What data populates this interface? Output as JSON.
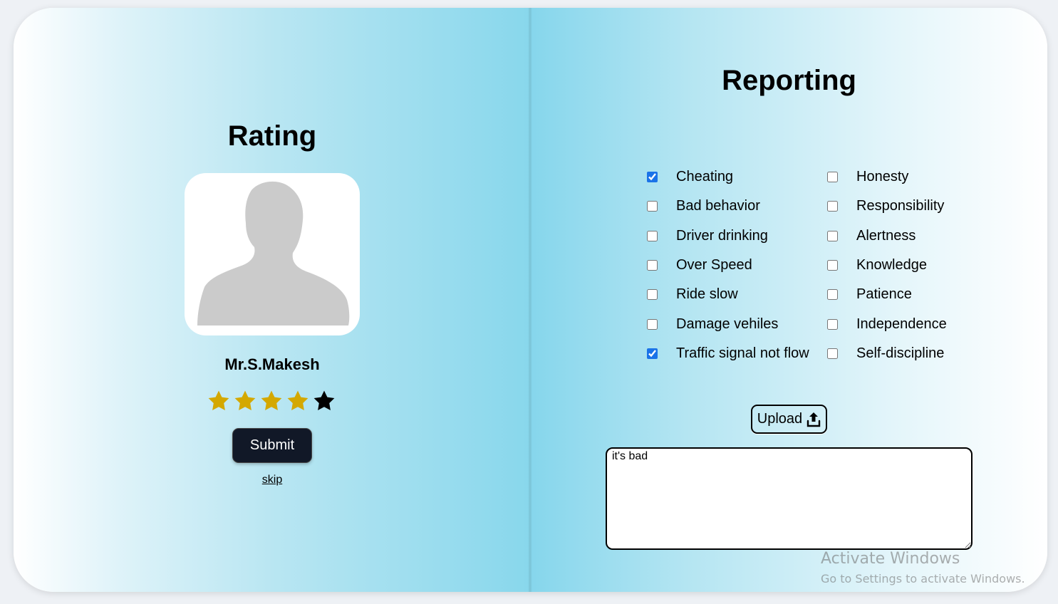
{
  "rating": {
    "title": "Rating",
    "driver_name": "Mr.S.Makesh",
    "stars_filled": 4,
    "stars_total": 5,
    "star_filled_color": "#d4a800",
    "star_empty_color": "#000000",
    "submit_label": "Submit",
    "skip_label": "skip"
  },
  "reporting": {
    "title": "Reporting",
    "issues": [
      {
        "label": "Cheating",
        "checked": true
      },
      {
        "label": "Bad behavior",
        "checked": false
      },
      {
        "label": "Driver drinking",
        "checked": false
      },
      {
        "label": "Over Speed",
        "checked": false
      },
      {
        "label": "Ride slow",
        "checked": false
      },
      {
        "label": "Damage vehiles",
        "checked": false
      },
      {
        "label": "Traffic signal not flow",
        "checked": true
      }
    ],
    "qualities": [
      {
        "label": "Honesty",
        "checked": false
      },
      {
        "label": "Responsibility",
        "checked": false
      },
      {
        "label": "Alertness",
        "checked": false
      },
      {
        "label": "Knowledge",
        "checked": false
      },
      {
        "label": "Patience",
        "checked": false
      },
      {
        "label": "Independence",
        "checked": false
      },
      {
        "label": "Self-discipline",
        "checked": false
      }
    ],
    "upload_label": "Upload",
    "upload_icon": "upload-icon",
    "comment_value": "it's bad"
  },
  "watermark": {
    "line1": "Activate Windows",
    "line2": "Go to Settings to activate Windows."
  }
}
